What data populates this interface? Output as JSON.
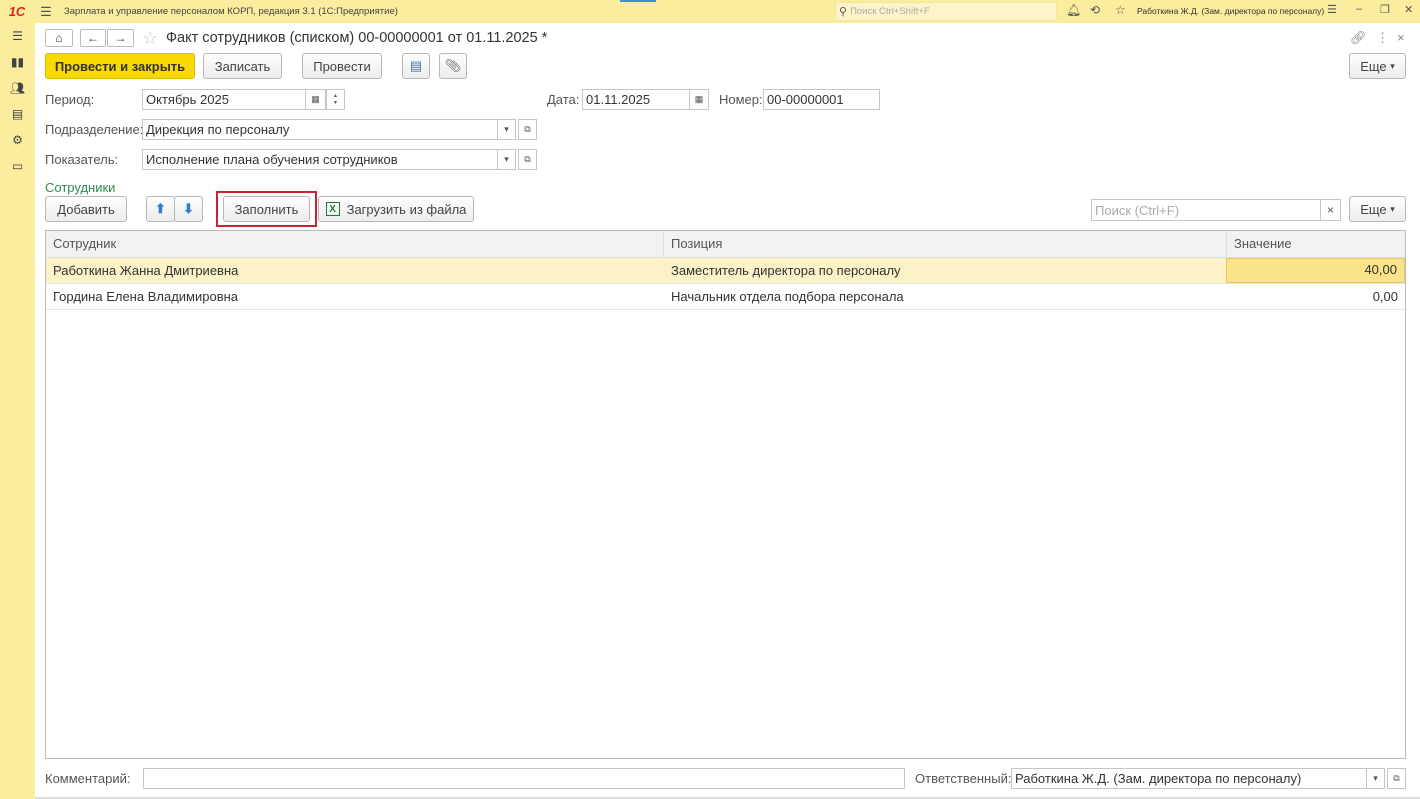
{
  "titlebar": {
    "logo": "1С",
    "app_title": "Зарплата и управление персоналом КОРП, редакция 3.1  (1С:Предприятие)",
    "search_placeholder": "Поиск Ctrl+Shift+F",
    "user": "Работкина Ж.Д. (Зам. директора по персоналу)"
  },
  "form": {
    "title": "Факт сотрудников (списком) 00-00000001 от 01.11.2025 *"
  },
  "toolbar": {
    "post_close": "Провести и закрыть",
    "save": "Записать",
    "post": "Провести",
    "more": "Еще"
  },
  "fields": {
    "period_label": "Период:",
    "period_value": "Октябрь 2025",
    "date_label": "Дата:",
    "date_value": "01.11.2025",
    "number_label": "Номер:",
    "number_value": "00-00000001",
    "department_label": "Подразделение:",
    "department_value": "Дирекция по персоналу",
    "indicator_label": "Показатель:",
    "indicator_value": "Исполнение плана обучения сотрудников"
  },
  "employees": {
    "section_title": "Сотрудники",
    "add": "Добавить",
    "fill": "Заполнить",
    "load_file": "Загрузить из файла",
    "search_placeholder": "Поиск (Ctrl+F)",
    "more": "Еще",
    "columns": [
      "Сотрудник",
      "Позиция",
      "Значение"
    ],
    "rows": [
      {
        "employee": "Работкина Жанна Дмитриевна",
        "position": "Заместитель директора по персоналу",
        "value": "40,00"
      },
      {
        "employee": "Гордина Елена Владимировна",
        "position": "Начальник отдела подбора персонала",
        "value": "0,00"
      }
    ]
  },
  "footer": {
    "comment_label": "Комментарий:",
    "comment_value": "",
    "responsible_label": "Ответственный:",
    "responsible_value": "Работкина Ж.Д. (Зам. директора по персоналу)"
  },
  "colors": {
    "titlebar_bg": "#fbed9e",
    "primary_button": "#f8d900",
    "section_title": "#2f8c4e",
    "highlight_box": "#c9252c",
    "selected_row": "#fcf2c8"
  }
}
